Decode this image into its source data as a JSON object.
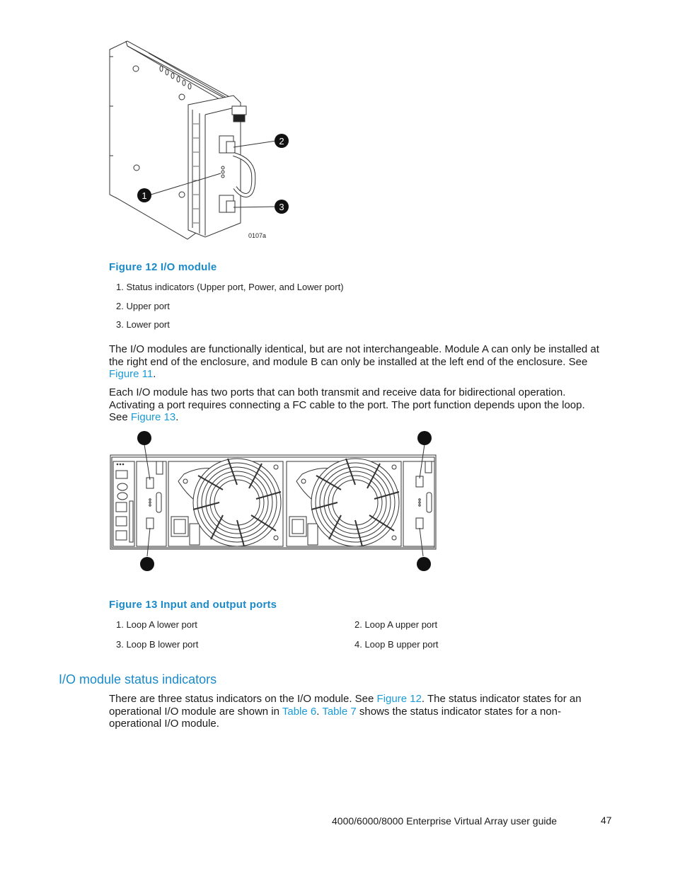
{
  "figure12": {
    "image_label": "0107a",
    "callouts": [
      "1",
      "2",
      "3"
    ],
    "caption": "Figure 12 I/O module",
    "items": [
      "1.  Status indicators (Upper port, Power, and Lower port)",
      "2.  Upper port",
      "3.  Lower port"
    ]
  },
  "para1": {
    "text": "The I/O modules are functionally identical, but are not interchangeable.  Module A can only be installed at the right end of the enclosure, and module B can only be installed at the left end of the enclosure.  See ",
    "link": "Figure 11",
    "end": "."
  },
  "para2": {
    "text": "Each I/O module has two ports that can both transmit and receive data for bidirectional operation. Activating a port requires connecting a FC cable to the port.  The port function depends upon the loop.  See ",
    "link": "Figure 13",
    "end": "."
  },
  "figure13": {
    "caption": "Figure 13 Input and output ports",
    "items_left": [
      "1.  Loop A lower port",
      "3.  Loop B lower port"
    ],
    "items_right": [
      "2.  Loop A upper port",
      "4.  Loop B upper port"
    ]
  },
  "section": {
    "heading": "I/O module status indicators",
    "t1": "There are three status indicators on the I/O module.  See ",
    "link1": "Figure 12",
    "t2": ".  The status indicator states for an operational I/O module are shown in ",
    "link2": "Table 6",
    "t3": ".  ",
    "link3": "Table 7",
    "t4": " shows the status indicator states for a non-operational I/O module."
  },
  "footer": {
    "title": "4000/6000/8000 Enterprise Virtual Array user guide",
    "page": "47"
  },
  "colors": {
    "accent": "#1a8ac8",
    "link": "#1a9ad6"
  }
}
